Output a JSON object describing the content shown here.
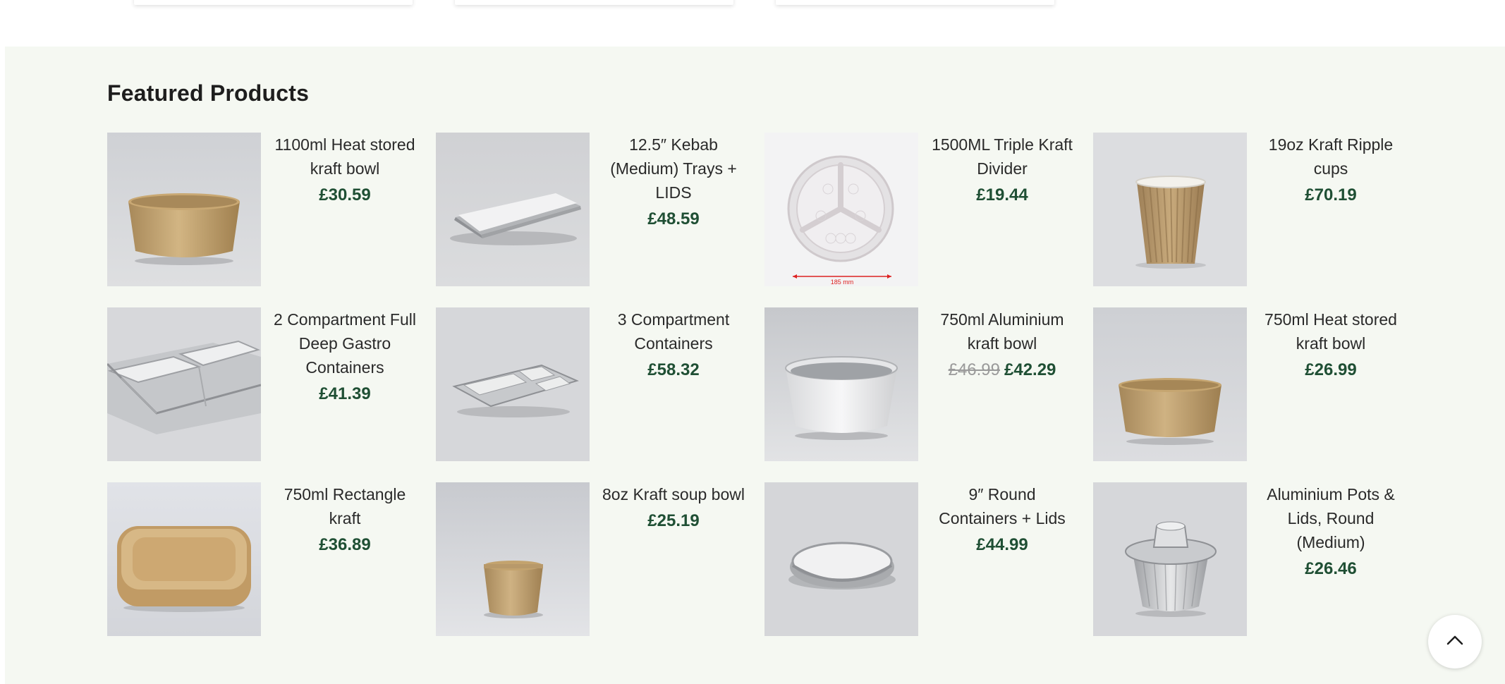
{
  "section": {
    "title": "Featured Products"
  },
  "products": [
    {
      "name": "1100ml Heat stored kraft bowl",
      "price": "£30.59",
      "old_price": "",
      "image": "kraft-bowl-icon"
    },
    {
      "name": "12.5″ Kebab (Medium) Trays + LIDS",
      "price": "£48.59",
      "old_price": "",
      "image": "foil-tray-lid-icon"
    },
    {
      "name": "1500ML Triple Kraft Divider",
      "price": "£19.44",
      "old_price": "",
      "image": "divider-plate-icon",
      "image_caption": "185 mm"
    },
    {
      "name": "19oz Kraft Ripple cups",
      "price": "£70.19",
      "old_price": "",
      "image": "ripple-cup-icon"
    },
    {
      "name": "2 Compartment Full Deep Gastro Containers",
      "price": "£41.39",
      "old_price": "",
      "image": "two-compartment-foil-icon"
    },
    {
      "name": "3 Compartment Containers",
      "price": "£58.32",
      "old_price": "",
      "image": "three-compartment-foil-icon"
    },
    {
      "name": "750ml Aluminium kraft bowl",
      "price": "£42.29",
      "old_price": "£46.99",
      "image": "aluminium-bowl-icon"
    },
    {
      "name": "750ml Heat stored kraft bowl",
      "price": "£26.99",
      "old_price": "",
      "image": "kraft-bowl-icon"
    },
    {
      "name": "750ml Rectangle kraft",
      "price": "£36.89",
      "old_price": "",
      "image": "rectangle-kraft-icon"
    },
    {
      "name": "8oz Kraft soup bowl",
      "price": "£25.19",
      "old_price": "",
      "image": "soup-cup-icon"
    },
    {
      "name": "9″ Round Containers + Lids",
      "price": "£44.99",
      "old_price": "",
      "image": "round-foil-lid-icon"
    },
    {
      "name": "Aluminium Pots & Lids, Round (Medium)",
      "price": "£26.46",
      "old_price": "",
      "image": "foil-pot-icon"
    }
  ],
  "back_to_top": {
    "icon": "chevron-up-icon"
  },
  "colors": {
    "section_bg": "#f5f8f2",
    "price": "#1f4f34",
    "old_price": "#9a9a9a",
    "title": "#1e1e1e"
  }
}
